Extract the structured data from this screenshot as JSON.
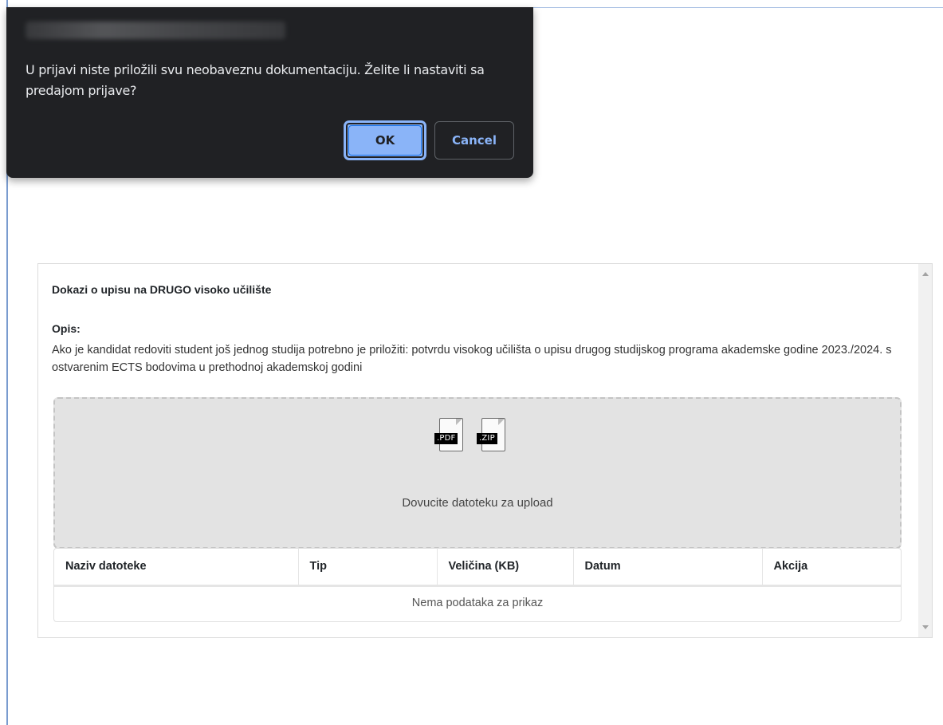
{
  "dialog": {
    "message": "U prijavi niste priložili svu neobaveznu dokumentaciju. Želite li nastaviti sa predajom prijave?",
    "ok_label": "OK",
    "cancel_label": "Cancel"
  },
  "panel": {
    "title": "Dokazi o upisu na DRUGO visoko učilište",
    "opis_label": "Opis:",
    "opis_text": "Ako je kandidat redoviti student još jednog studija potrebno je priložiti: potvrdu visokog učilišta o upisu drugog studijskog programa akademske godine 2023./2024. s ostvarenim ECTS bodovima u prethodnoj akademskoj godini",
    "dropzone": {
      "file_types": [
        ".PDF",
        ".ZIP"
      ],
      "icons": [
        "pdf-file-icon",
        "zip-file-icon"
      ],
      "text": "Dovucite datoteku za upload"
    },
    "table": {
      "columns": [
        "Naziv datoteke",
        "Tip",
        "Veličina (KB)",
        "Datum",
        "Akcija"
      ],
      "empty_text": "Nema podataka za prikaz"
    }
  },
  "colors": {
    "dialog_bg": "#202124",
    "ok_button": "#8ab4f8",
    "dropzone_bg": "#e3e3e3"
  }
}
